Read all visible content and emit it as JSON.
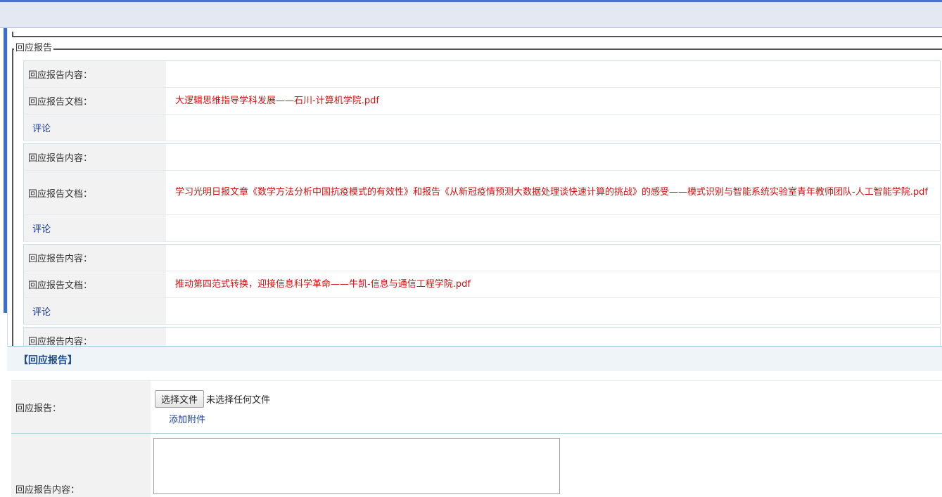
{
  "legend": "回应报告",
  "labels": {
    "content": "回应报告内容：",
    "doc": "回应报告文档：",
    "comment": "评论"
  },
  "reports": [
    {
      "doc": "大逻辑思维指导学科发展——石川-计算机学院.pdf"
    },
    {
      "doc": "学习光明日报文章《数学方法分析中国抗疫模式的有效性》和报告《从新冠疫情预测大数据处理谈快速计算的挑战》的感受——模式识别与智能系统实验室青年教师团队-人工智能学院.pdf"
    },
    {
      "doc": "推动第四范式转换，迎接信息科学革命——牛凯-信息与通信工程学院.pdf"
    }
  ],
  "section_title": "【回应报告】",
  "form": {
    "report_label": "回应报告：",
    "file_button": "选择文件",
    "no_file": "未选择任何文件",
    "add_attachment": "添加附件",
    "content_label": "回应报告内容："
  }
}
